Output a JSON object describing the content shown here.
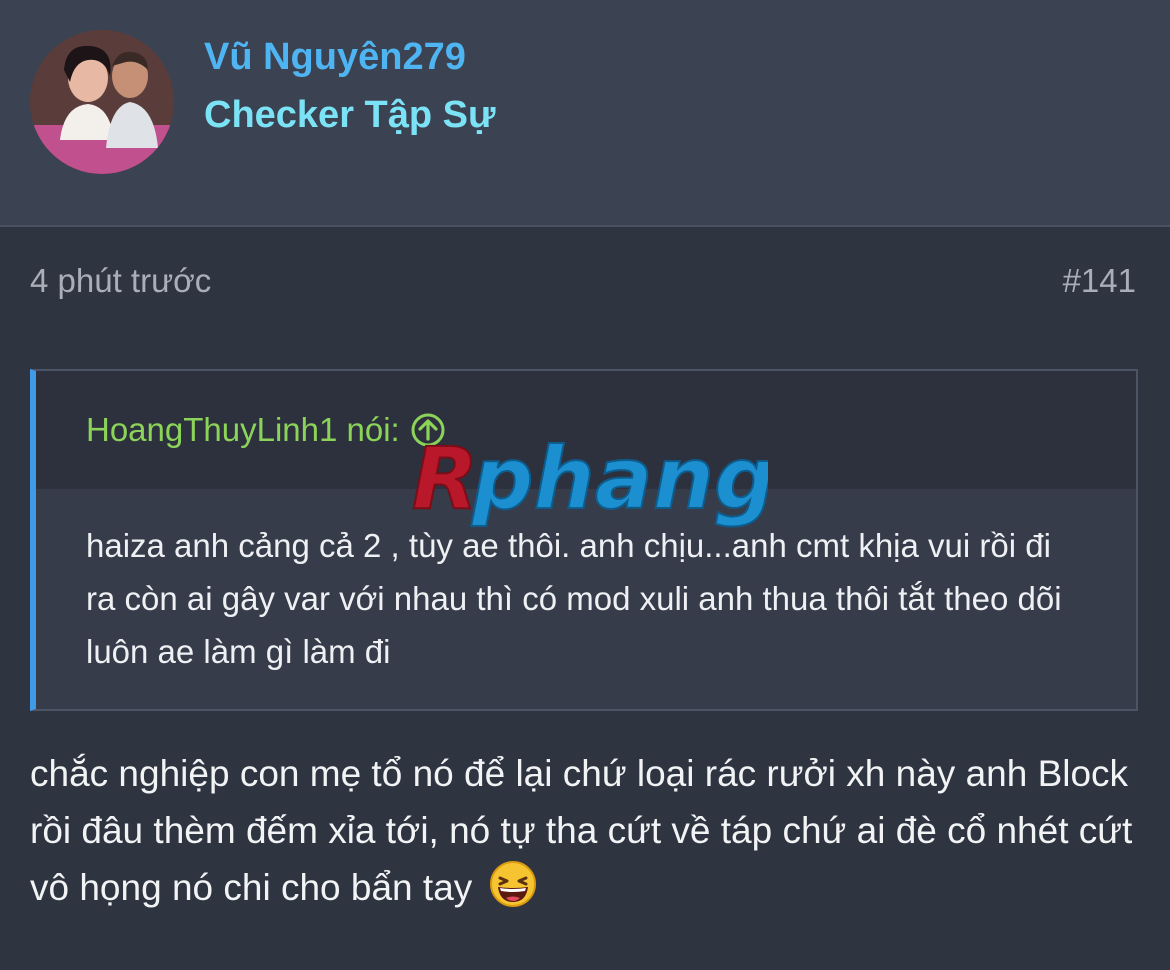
{
  "user": {
    "name": "Vũ Nguyên279",
    "title": "Checker Tập Sự",
    "avatar_icon": "avatar-photo"
  },
  "post": {
    "time": "4 phút trước",
    "number": "#141"
  },
  "quote": {
    "author": "HoangThuyLinh1 nói:",
    "jump_icon": "arrow-up-circle-icon",
    "body": "haiza anh cảng cả 2 , tùy ae thôi. anh chịu...anh cmt khịa vui rồi đi ra còn ai gây var với nhau thì có mod xuli anh thua thôi tắt theo dõi luôn ae làm gì làm đi"
  },
  "watermark": {
    "text": "Rphang"
  },
  "message": {
    "text": "chắc nghiệp con mẹ tổ nó để lại chứ loại rác rưởi xh này anh Block rồi đâu thèm đếm xỉa tới, nó tự tha cứt về táp chứ ai đè cổ nhét cứt vô họng nó chi cho bẩn tay",
    "emoji_icon": "laughing-face-emoji"
  },
  "colors": {
    "page_bg": "#2f3441",
    "header_bg": "#3b4252",
    "username": "#4fb4f2",
    "user_title": "#7be3f5",
    "quote_author": "#8cd35a",
    "quote_accent": "#3f9be8",
    "meta_text": "#a9aeb8"
  }
}
